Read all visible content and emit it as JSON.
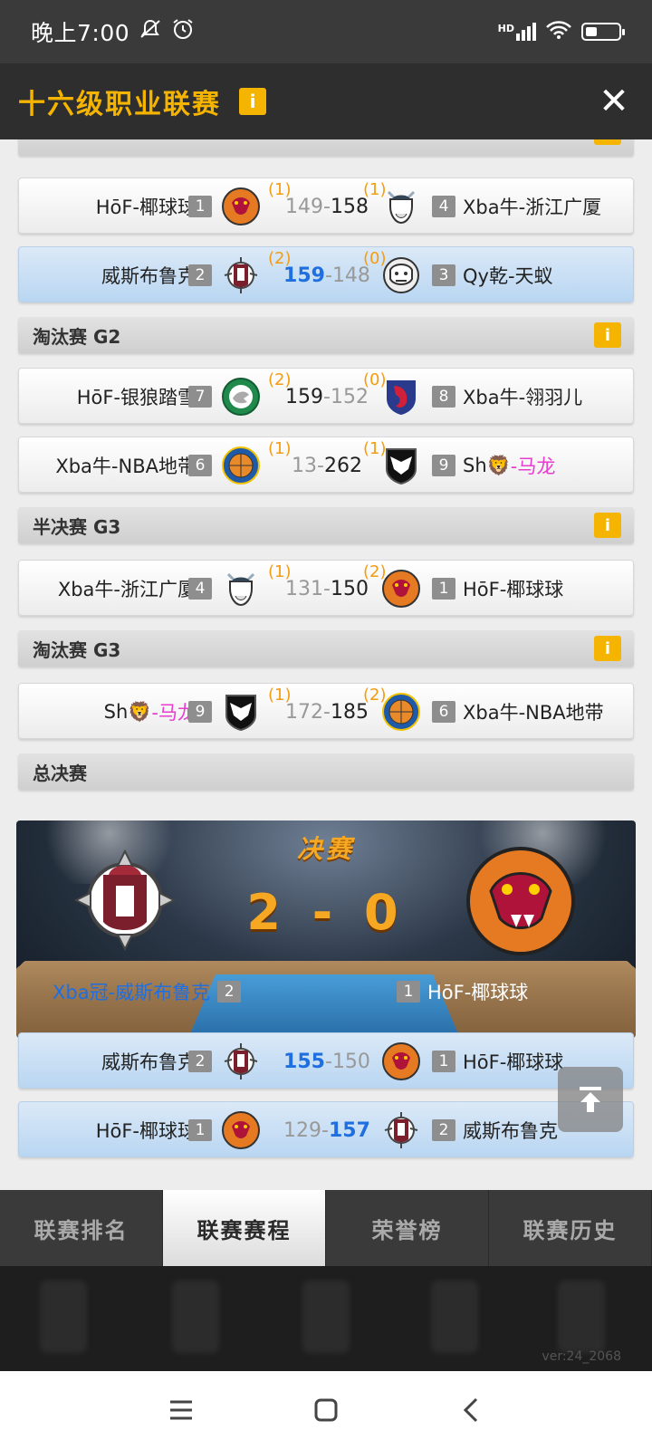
{
  "status_bar": {
    "time": "晚上7:00",
    "network": "HD"
  },
  "header": {
    "title": "十六级职业联赛",
    "info_label": "i",
    "close_label": "✕"
  },
  "matches": [
    {
      "home": {
        "name": "HōF-椰球球",
        "seed": "1",
        "wins": "(1)"
      },
      "away": {
        "name": "Xba牛-浙江广厦",
        "seed": "4",
        "wins": "(1)"
      },
      "home_score": "149",
      "away_score": "158",
      "sep": "-"
    },
    {
      "home": {
        "name": "威斯布鲁克",
        "seed": "2",
        "wins": "(2)"
      },
      "away": {
        "name": "Qy乾-天蚁",
        "seed": "3",
        "wins": "(0)"
      },
      "home_score": "159",
      "away_score": "148",
      "sep": "-"
    },
    {
      "home": {
        "name": "HōF-银狼踏雪",
        "seed": "7",
        "wins": "(2)"
      },
      "away": {
        "name": "Xba牛-翎羽儿",
        "seed": "8",
        "wins": "(0)"
      },
      "home_score": "159",
      "away_score": "152",
      "sep": "-"
    },
    {
      "home": {
        "name": "Xba牛-NBA地带",
        "seed": "6",
        "wins": "(1)"
      },
      "away": {
        "name_prefix": "Sh",
        "name_emoji": "🦁",
        "name_suffix": "-马龙",
        "seed": "9",
        "wins": "(1)"
      },
      "home_score": "13",
      "away_score": "262",
      "sep": "-"
    },
    {
      "home": {
        "name": "Xba牛-浙江广厦",
        "seed": "4",
        "wins": "(1)"
      },
      "away": {
        "name": "HōF-椰球球",
        "seed": "1",
        "wins": "(2)"
      },
      "home_score": "131",
      "away_score": "150",
      "sep": "-"
    },
    {
      "home": {
        "name_prefix": "Sh",
        "name_emoji": "🦁",
        "name_suffix": "-马龙",
        "seed": "9",
        "wins": "(1)"
      },
      "away": {
        "name": "Xba牛-NBA地带",
        "seed": "6",
        "wins": "(2)"
      },
      "home_score": "172",
      "away_score": "185",
      "sep": "-"
    },
    {
      "home": {
        "name": "威斯布鲁克",
        "seed": "2"
      },
      "away": {
        "name": "HōF-椰球球",
        "seed": "1"
      },
      "home_score": "155",
      "away_score": "150",
      "sep": "-"
    },
    {
      "home": {
        "name": "HōF-椰球球",
        "seed": "1"
      },
      "away": {
        "name": "威斯布鲁克",
        "seed": "2"
      },
      "home_score": "129",
      "away_score": "157",
      "sep": "-"
    }
  ],
  "sections": {
    "knockout_g2": "淘汰赛 G2",
    "semi_g3": "半决赛 G3",
    "knockout_g3": "淘汰赛 G3",
    "finals": "总决赛",
    "info_label": "i"
  },
  "final": {
    "title": "决赛",
    "score": "2 - 0",
    "left_name": "Xba冠-威斯布鲁克",
    "left_seed": "2",
    "right_name": "HōF-椰球球",
    "right_seed": "1"
  },
  "tabs": [
    "联赛排名",
    "联赛赛程",
    "荣誉榜",
    "联赛历史"
  ],
  "active_tab": "联赛赛程",
  "version": "ver:24_2068",
  "colors": {
    "accent": "#f4b400",
    "winner_blue": "#1f6fe0",
    "wins_orange": "#f39c12",
    "highlight_row": "#c9def4"
  },
  "icons": [
    "silent-icon",
    "alarm-icon",
    "signal-icon",
    "wifi-icon",
    "battery-icon",
    "info-icon",
    "close-icon",
    "spartan-helmet-logo",
    "snake-basketball-logo",
    "viking-logo",
    "gorilla-logo",
    "wolf-logo",
    "red-dragon-logo",
    "basketball-logo",
    "eagle-shield-logo",
    "back-to-top-icon",
    "menu-icon",
    "home-icon",
    "back-icon"
  ]
}
